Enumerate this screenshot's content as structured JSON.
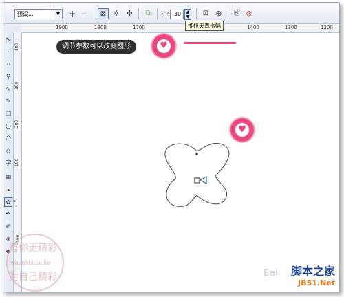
{
  "toolbar": {
    "preset_value": "预设...",
    "add_label": "+",
    "remove_label": "−",
    "amplitude_value": "-30",
    "tooltip_text": "推拉失真振幅"
  },
  "ruler_top": {
    "labels": [
      "1900",
      "1800",
      "1700",
      "1400",
      "1300",
      "1200"
    ]
  },
  "ruler_left": {
    "labels": [
      "400",
      "300",
      "200",
      "100",
      "0",
      "-100"
    ]
  },
  "toolbox": {
    "text_tool_label": "字"
  },
  "callout": {
    "text": "调节参数可以改变图形"
  },
  "watermark": {
    "line1": "有你更精彩",
    "line2": "wangzhidaoke",
    "line3": "为自己精彩"
  },
  "brand": {
    "name": "脚本之家",
    "url": "JB51.Net"
  },
  "baidu": "Bai",
  "colors": {
    "accent_pink": "#e8477f",
    "toolbar_bg": "#e6ebf2"
  }
}
